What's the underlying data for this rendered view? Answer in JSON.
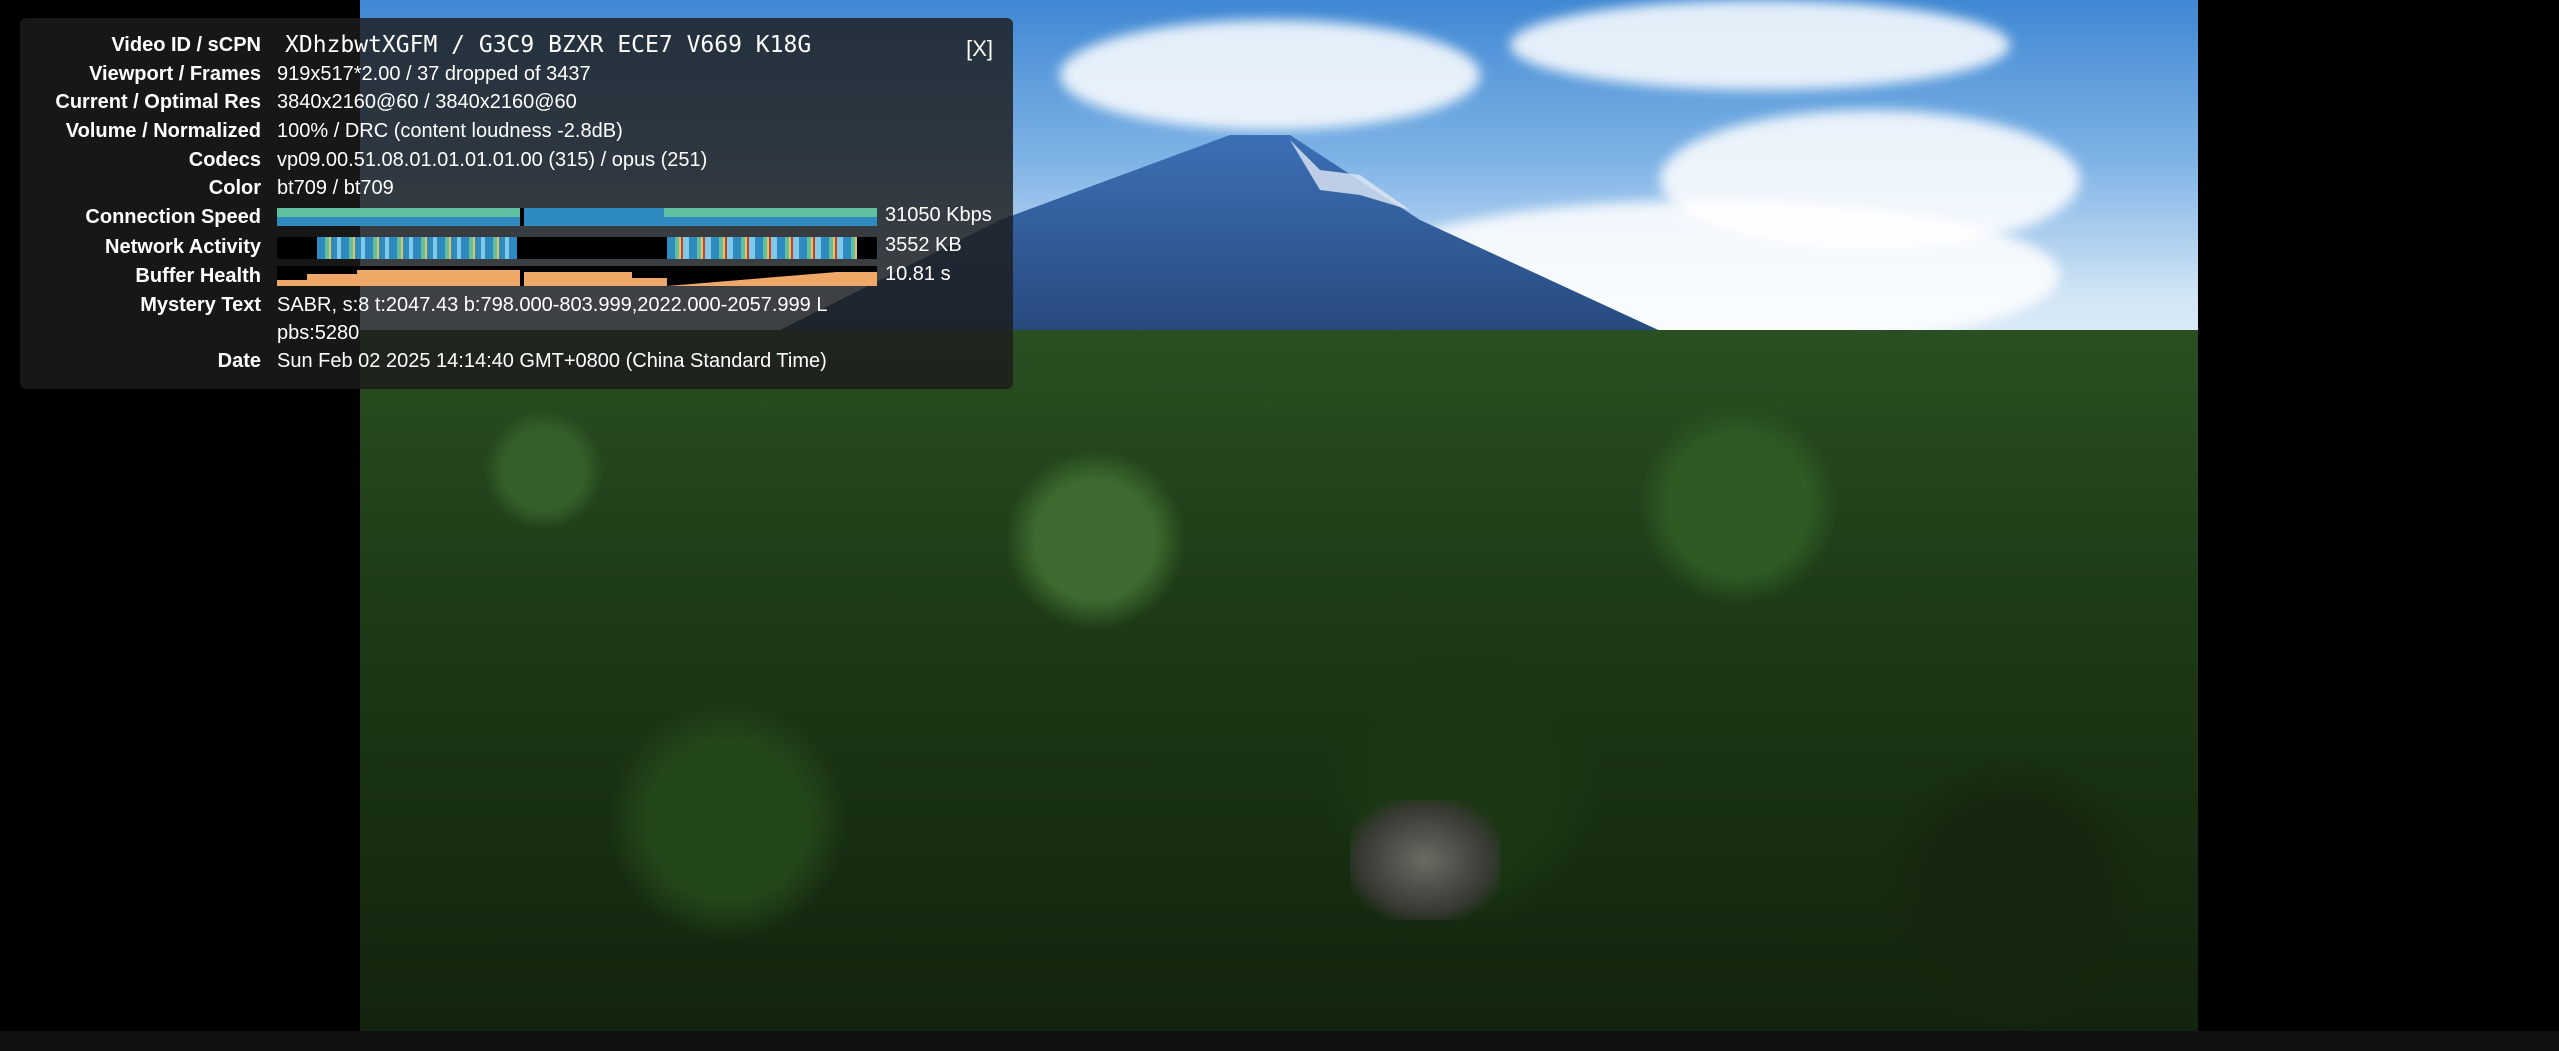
{
  "stats": {
    "close_label": "[X]",
    "rows": [
      {
        "label": "Video ID / sCPN",
        "value": "XDhzbwtXGFM / G3C9 BZXR ECE7 V669 K18G"
      },
      {
        "label": "Viewport / Frames",
        "value": "919x517*2.00 / 37 dropped of 3437"
      },
      {
        "label": "Current / Optimal Res",
        "value": "3840x2160@60 / 3840x2160@60"
      },
      {
        "label": "Volume / Normalized",
        "value": "100% / DRC (content loudness -2.8dB)"
      },
      {
        "label": "Codecs",
        "value": "vp09.00.51.08.01.01.01.01.00 (315) / opus (251)"
      },
      {
        "label": "Color",
        "value": "bt709 / bt709"
      },
      {
        "label": "Connection Speed",
        "value": "31050 Kbps"
      },
      {
        "label": "Network Activity",
        "value": "3552 KB"
      },
      {
        "label": "Buffer Health",
        "value": "10.81 s"
      },
      {
        "label": "Mystery Text",
        "value": "SABR, s:8 t:2047.43 b:798.000-803.999,2022.000-2057.999 L",
        "value2": "pbs:5280"
      },
      {
        "label": "Date",
        "value": "Sun Feb 02 2025 14:14:40 GMT+0800 (China Standard Time)"
      }
    ],
    "colors": {
      "connection_speed": "#5fbfa0",
      "connection_speed_alt": "#2f8ac0",
      "buffer_health": "#f0a868",
      "network_activity": [
        "#2f8ac0",
        "#5fbfa0",
        "#e8c060",
        "#c04030"
      ]
    }
  }
}
